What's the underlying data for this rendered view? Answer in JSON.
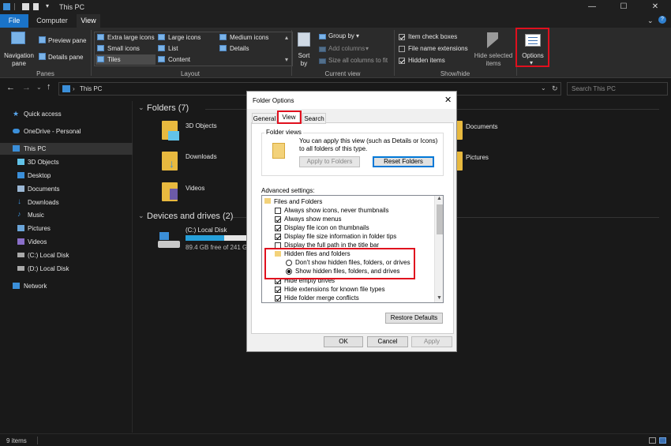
{
  "window": {
    "title": "This PC",
    "minimize": "—",
    "maximize": "☐",
    "close": "✕"
  },
  "ribbon_tabs": [
    "File",
    "Computer",
    "View"
  ],
  "ribbon": {
    "panes": {
      "navigation_pane": "Navigation pane",
      "preview_pane": "Preview pane",
      "details_pane": "Details pane",
      "group": "Panes"
    },
    "layout": {
      "items": [
        "Extra large icons",
        "Large icons",
        "Medium icons",
        "Small icons",
        "List",
        "Details",
        "Tiles",
        "Content"
      ],
      "group": "Layout"
    },
    "current_view": {
      "sort_by": "Sort by",
      "group_by": "Group by",
      "add_columns": "Add columns",
      "size_all_columns": "Size all columns to fit",
      "group": "Current view"
    },
    "show_hide": {
      "item_check_boxes": "Item check boxes",
      "file_name_extensions": "File name extensions",
      "hidden_items": "Hidden items",
      "hide_selected_items": "Hide selected items",
      "group": "Show/hide"
    },
    "options": "Options"
  },
  "address": {
    "path": "This PC",
    "search_placeholder": "Search This PC"
  },
  "nav": {
    "items": [
      "Quick access",
      "OneDrive - Personal",
      "This PC",
      "3D Objects",
      "Desktop",
      "Documents",
      "Downloads",
      "Music",
      "Pictures",
      "Videos",
      "(C:) Local Disk",
      "(D:) Local Disk",
      "Network"
    ]
  },
  "main": {
    "folders_header": "Folders (7)",
    "folders": [
      "3D Objects",
      "Documents",
      "Downloads",
      "Pictures",
      "Videos"
    ],
    "drives_header": "Devices and drives (2)",
    "drive_name": "(C:) Local Disk",
    "drive_free": "89.4 GB free of 241 GB",
    "drive_used_fraction": 0.63
  },
  "status": {
    "count": "9 items"
  },
  "dialog": {
    "title": "Folder Options",
    "tabs": [
      "General",
      "View",
      "Search"
    ],
    "folder_views_label": "Folder views",
    "folder_views_text": "You can apply this view (such as Details or Icons) to all folders of this type.",
    "apply_to_folders": "Apply to Folders",
    "reset_folders": "Reset Folders",
    "advanced_label": "Advanced settings:",
    "settings": [
      "Files and Folders",
      "Always show icons, never thumbnails",
      "Always show menus",
      "Display file icon on thumbnails",
      "Display file size information in folder tips",
      "Display the full path in the title bar",
      "Hidden files and folders",
      "Don't show hidden files, folders, or drives",
      "Show hidden files, folders, and drives",
      "Hide empty drives",
      "Hide extensions for known file types",
      "Hide folder merge conflicts"
    ],
    "restore_defaults": "Restore Defaults",
    "ok": "OK",
    "cancel": "Cancel",
    "apply": "Apply"
  },
  "colors": {
    "accent": "#1a73c8",
    "highlight": "#e0101e",
    "bg": "#191919"
  }
}
